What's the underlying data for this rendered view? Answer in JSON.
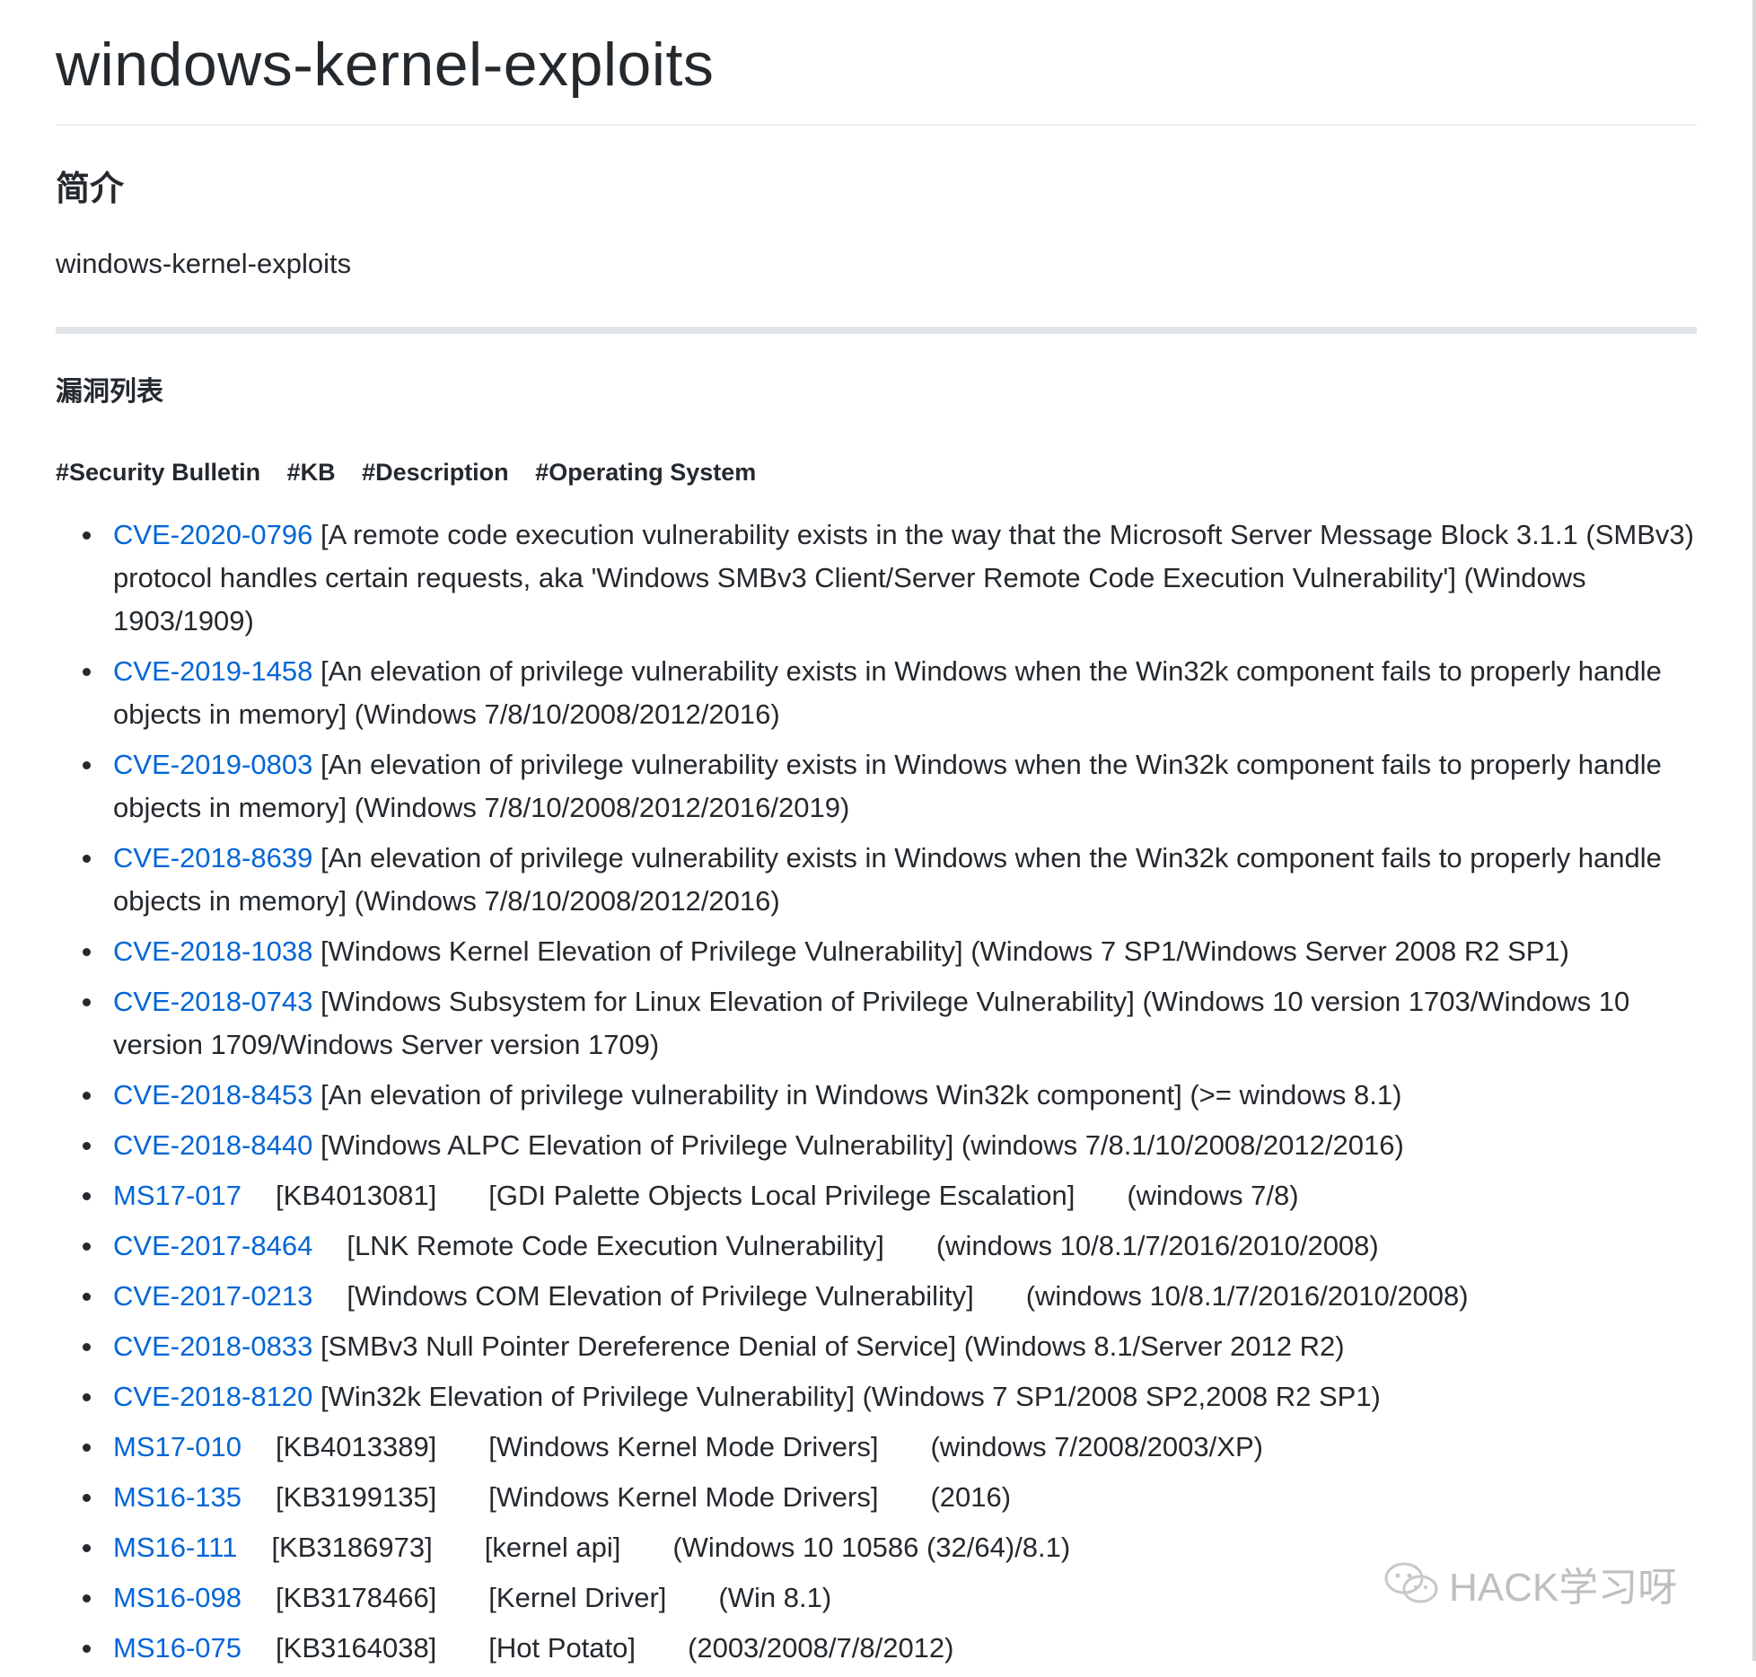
{
  "title": "windows-kernel-exploits",
  "intro_heading": "简介",
  "intro_text": "windows-kernel-exploits",
  "list_heading": "漏洞列表",
  "columns": [
    "#Security Bulletin",
    "#KB",
    "#Description",
    "#Operating System"
  ],
  "items": [
    {
      "id": "CVE-2020-0796",
      "kb": "",
      "desc": "[A remote code execution vulnerability exists in the way that the Microsoft Server Message Block 3.1.1 (SMBv3) protocol handles certain requests, aka 'Windows SMBv3 Client/Server Remote Code Execution Vulnerability']",
      "os": "(Windows 1903/1909)"
    },
    {
      "id": "CVE-2019-1458",
      "kb": "",
      "desc": "[An elevation of privilege vulnerability exists in Windows when the Win32k component fails to properly handle objects in memory]",
      "os": "(Windows 7/8/10/2008/2012/2016)"
    },
    {
      "id": "CVE-2019-0803",
      "kb": "",
      "desc": "[An elevation of privilege vulnerability exists in Windows when the Win32k component fails to properly handle objects in memory]",
      "os": "(Windows 7/8/10/2008/2012/2016/2019)"
    },
    {
      "id": "CVE-2018-8639",
      "kb": "",
      "desc": "[An elevation of privilege vulnerability exists in Windows when the Win32k component fails to properly handle objects in memory]",
      "os": "(Windows 7/8/10/2008/2012/2016)"
    },
    {
      "id": "CVE-2018-1038",
      "kb": "",
      "desc": "[Windows Kernel Elevation of Privilege Vulnerability]",
      "os": "(Windows 7 SP1/Windows Server 2008 R2 SP1)"
    },
    {
      "id": "CVE-2018-0743",
      "kb": "",
      "desc": "[Windows Subsystem for Linux Elevation of Privilege Vulnerability]",
      "os": "(Windows 10 version 1703/Windows 10 version 1709/Windows Server version 1709)"
    },
    {
      "id": "CVE-2018-8453",
      "kb": "",
      "desc": "[An elevation of privilege vulnerability in Windows Win32k component]",
      "os": "(>= windows 8.1)"
    },
    {
      "id": "CVE-2018-8440",
      "kb": "",
      "desc": "[Windows ALPC Elevation of Privilege Vulnerability]",
      "os": "(windows 7/8.1/10/2008/2012/2016)"
    },
    {
      "id": "MS17-017",
      "kb": "[KB4013081]",
      "desc": "[GDI Palette Objects Local Privilege Escalation]",
      "os": "(windows 7/8)"
    },
    {
      "id": "CVE-2017-8464",
      "kb": "",
      "desc": "[LNK Remote Code Execution Vulnerability]",
      "os": "(windows 10/8.1/7/2016/2010/2008)"
    },
    {
      "id": "CVE-2017-0213",
      "kb": "",
      "desc": "[Windows COM Elevation of Privilege Vulnerability]",
      "os": "(windows 10/8.1/7/2016/2010/2008)"
    },
    {
      "id": "CVE-2018-0833",
      "kb": "",
      "desc": "[SMBv3 Null Pointer Dereference Denial of Service]",
      "os": "(Windows 8.1/Server 2012 R2)"
    },
    {
      "id": "CVE-2018-8120",
      "kb": "",
      "desc": "[Win32k Elevation of Privilege Vulnerability]",
      "os": "(Windows 7 SP1/2008 SP2,2008 R2 SP1)"
    },
    {
      "id": "MS17-010",
      "kb": "[KB4013389]",
      "desc": "[Windows Kernel Mode Drivers]",
      "os": "(windows 7/2008/2003/XP)"
    },
    {
      "id": "MS16-135",
      "kb": "[KB3199135]",
      "desc": "[Windows Kernel Mode Drivers]",
      "os": "(2016)"
    },
    {
      "id": "MS16-111",
      "kb": "[KB3186973]",
      "desc": "[kernel api]",
      "os": "(Windows 10 10586 (32/64)/8.1)"
    },
    {
      "id": "MS16-098",
      "kb": "[KB3178466]",
      "desc": "[Kernel Driver]",
      "os": "(Win 8.1)"
    },
    {
      "id": "MS16-075",
      "kb": "[KB3164038]",
      "desc": "[Hot Potato]",
      "os": "(2003/2008/7/8/2012)"
    }
  ],
  "watermark": "HACK学习呀",
  "colors": {
    "link": "#0366d6",
    "text": "#24292e",
    "rule": "#eaecef"
  }
}
